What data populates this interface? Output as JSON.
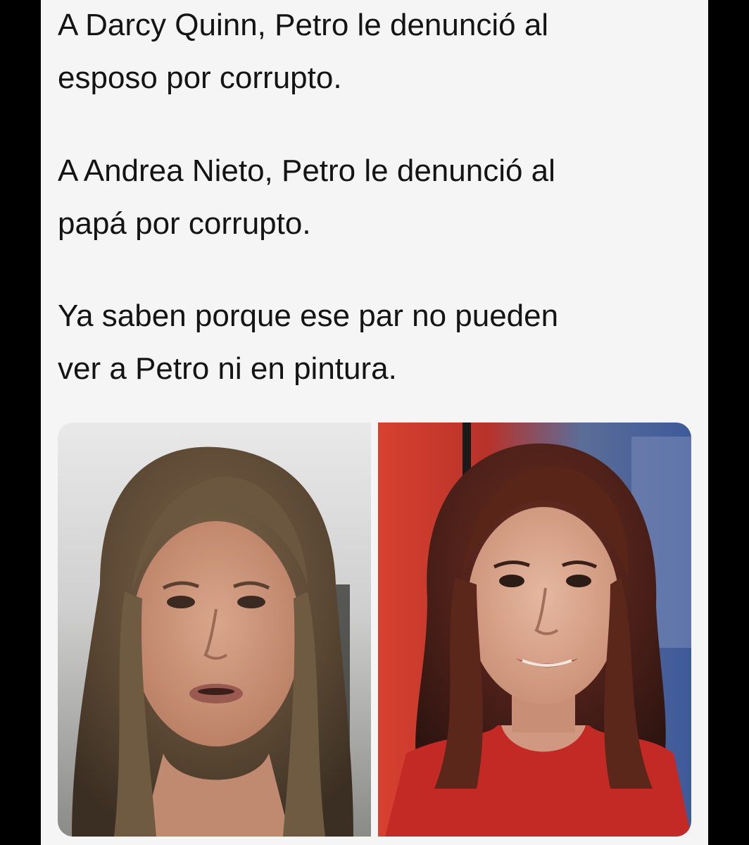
{
  "tweet": {
    "paragraphs": [
      "A Darcy Quinn, Petro le denunció al esposo por corrupto.",
      "A Andrea Nieto, Petro le denunció al papá por corrupto.",
      "Ya saben porque ese par no pueden ver a Petro ni en pintura."
    ],
    "lines": [
      [
        "A Darcy Quinn, Petro le denunció al",
        "esposo por corrupto."
      ],
      [
        "A Andrea Nieto, Petro le denunció al",
        "papá por corrupto."
      ],
      [
        "Ya saben porque ese par no pueden",
        "ver a Petro ni en pintura."
      ]
    ]
  },
  "media": {
    "photos": [
      {
        "subject": "woman-with-long-light-brown-hair-talking-to-camera",
        "icon": "photo-left"
      },
      {
        "subject": "woman-with-wavy-brown-hair-red-top-studio-background",
        "icon": "photo-right"
      }
    ]
  },
  "colors": {
    "background": "#000000",
    "card": "#f5f5f5",
    "text": "#141414"
  }
}
